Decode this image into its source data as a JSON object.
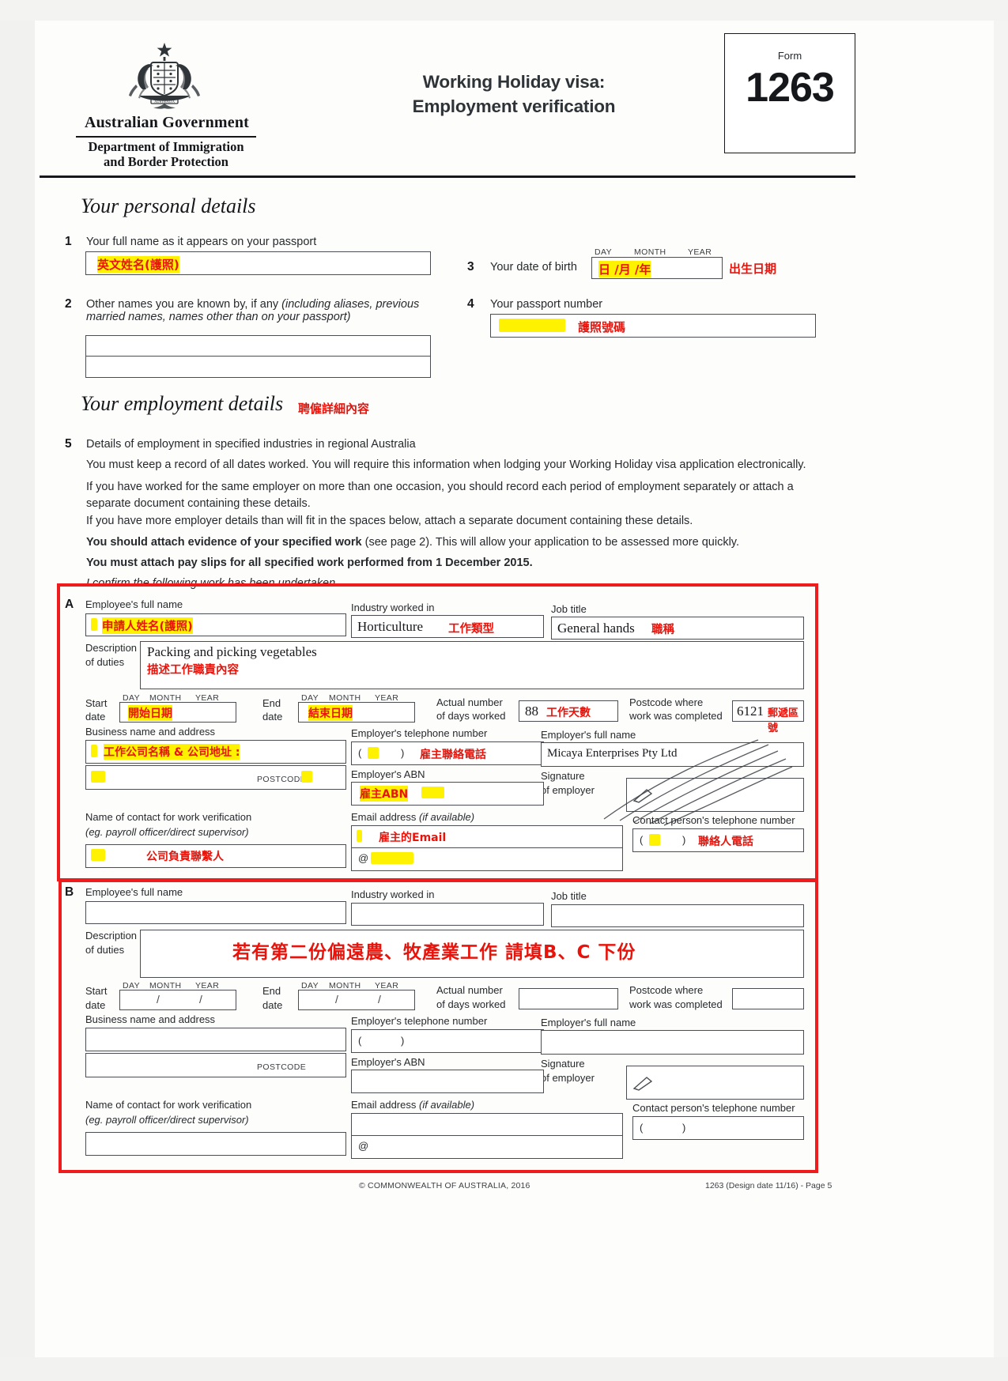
{
  "header": {
    "government": "Australian Government",
    "department_line1": "Department of Immigration",
    "department_line2": "and Border Protection",
    "title_line1": "Working Holiday visa:",
    "title_line2": "Employment verification",
    "form_label": "Form",
    "form_number": "1263"
  },
  "personal": {
    "heading": "Your personal details",
    "q1": {
      "num": "1",
      "label": "Your full name as it appears on your passport",
      "value_annotation": "英文姓名(護照)"
    },
    "q2": {
      "num": "2",
      "label": "Other names you are known by, if any",
      "label_italic": "(including aliases, previous married names, names other than on your passport)",
      "value": ""
    },
    "q3": {
      "num": "3",
      "label": "Your date of birth",
      "day": "DAY",
      "month": "MONTH",
      "year": "YEAR",
      "value_annotation": "日 /月 /年",
      "side_annotation": "出生日期"
    },
    "q4": {
      "num": "4",
      "label": "Your passport number",
      "value_annotation": "護照號碼"
    }
  },
  "employment": {
    "heading": "Your employment details",
    "heading_annotation": "聘僱詳細內容",
    "q5_num": "5",
    "q5_title": "Details of employment in specified industries in regional Australia",
    "paragraphs": [
      "You must keep a record of all dates worked. You will require this information when lodging your Working Holiday visa application electronically.",
      "If you have worked for the same employer on more than one occasion, you should record each period of employment separately or attach a separate document containing these details.",
      "If you have more employer details than will fit in the spaces below, attach a separate document containing these details."
    ],
    "bold_line1_strong": "You should attach evidence of your specified work",
    "bold_line1_rest": " (see page 2). This will allow your application to be assessed more quickly.",
    "bold_line2": "You must attach pay slips for all specified work performed from 1 December 2015.",
    "confirm_line": "I confirm the following work has been undertaken"
  },
  "labels": {
    "employee_name": "Employee's full name",
    "industry": "Industry worked in",
    "job_title": "Job title",
    "description_l1": "Description",
    "description_l2": "of duties",
    "start_l1": "Start",
    "start_l2": "date",
    "end_l1": "End",
    "end_l2": "date",
    "day": "DAY",
    "month": "MONTH",
    "year": "YEAR",
    "actual_days_l1": "Actual number",
    "actual_days_l2": "of days worked",
    "postcode_where_l1": "Postcode where",
    "postcode_where_l2": "work was completed",
    "business_name": "Business name and address",
    "employer_phone": "Employer's telephone number",
    "employer_name": "Employer's full name",
    "employer_abn": "Employer's ABN",
    "signature_l1": "Signature",
    "signature_l2": "of employer",
    "postcode": "POSTCODE",
    "contact_name_l1": "Name of contact for work verification",
    "contact_name_l2": "(eg. payroll officer/direct supervisor)",
    "email": "Email address",
    "email_italic": "(if available)",
    "contact_phone": "Contact person's telephone number",
    "at_sign": "@"
  },
  "block_a": {
    "letter": "A",
    "employee_name_annotation": "申請人姓名(護照)",
    "industry_value": "Horticulture",
    "industry_annotation": "工作類型",
    "job_title_value": "General hands",
    "job_title_annotation": "職稱",
    "duties_value": "Packing and picking vegetables",
    "duties_annotation": "描述工作職責內容",
    "start_annotation": "開始日期",
    "end_annotation": "結束日期",
    "days_value": "88",
    "days_annotation": "工作天數",
    "postcode_value": "6121",
    "postcode_annotation": "郵遞區號",
    "business_annotation": "工作公司名稱 & 公司地址 :",
    "employer_phone_annotation": "雇主聯絡電話",
    "employer_name_value": "Micaya Enterprises Pty Ltd",
    "employer_abn_annotation": "雇主ABN",
    "contact_name_annotation": "公司負責聯繫人",
    "email_annotation": "雇主的Email",
    "contact_phone_annotation": "聯絡人電話",
    "phone_open": "(",
    "phone_close": ")"
  },
  "block_b": {
    "letter": "B",
    "center_note": "若有第二份偏遠農、牧產業工作 請填B、C 下份"
  },
  "footer": {
    "copyright": "© COMMONWEALTH OF AUSTRALIA, 2016",
    "doc_ref": "1263 (Design date 11/16) - Page 5"
  },
  "colors": {
    "annotation_red": "#e8140c",
    "highlight_yellow": "#fff200",
    "review_box_red": "#ee1c1c"
  }
}
